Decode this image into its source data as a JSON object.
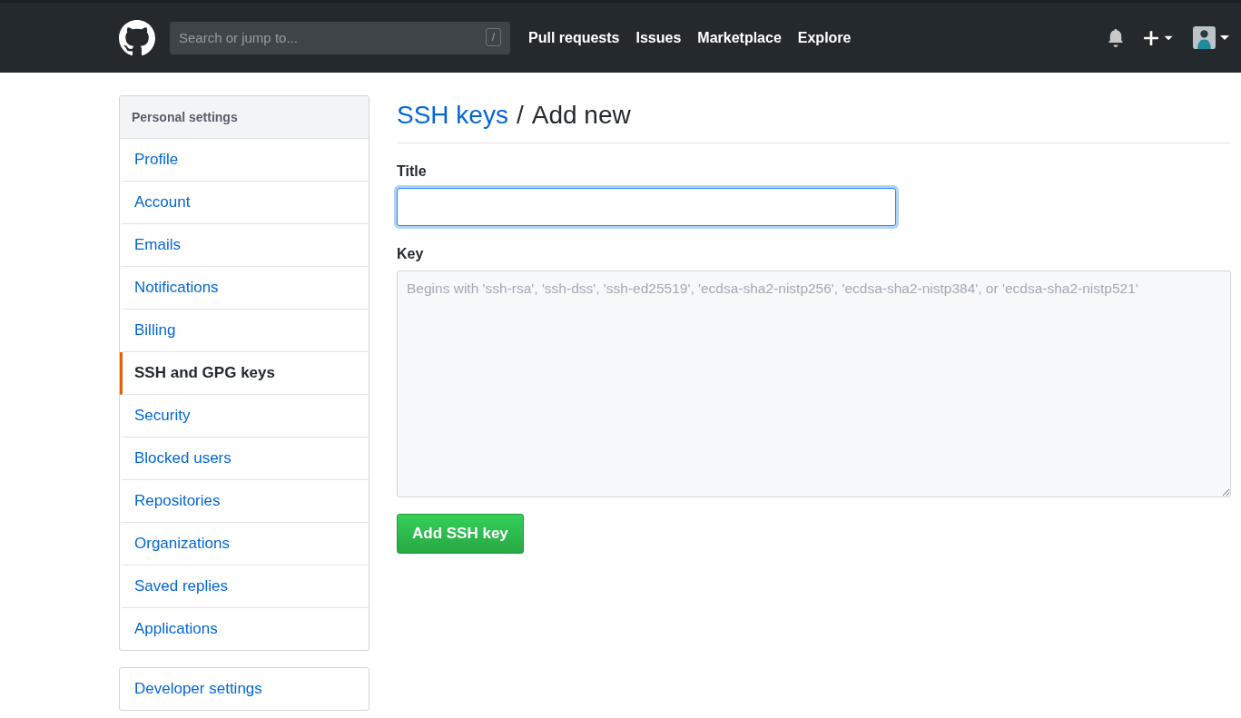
{
  "header": {
    "search": {
      "placeholder": "Search or jump to...",
      "shortcut": "/"
    },
    "nav": [
      "Pull requests",
      "Issues",
      "Marketplace",
      "Explore"
    ]
  },
  "sidebar": {
    "heading": "Personal settings",
    "items": [
      {
        "label": "Profile",
        "selected": false
      },
      {
        "label": "Account",
        "selected": false
      },
      {
        "label": "Emails",
        "selected": false
      },
      {
        "label": "Notifications",
        "selected": false
      },
      {
        "label": "Billing",
        "selected": false
      },
      {
        "label": "SSH and GPG keys",
        "selected": true
      },
      {
        "label": "Security",
        "selected": false
      },
      {
        "label": "Blocked users",
        "selected": false
      },
      {
        "label": "Repositories",
        "selected": false
      },
      {
        "label": "Organizations",
        "selected": false
      },
      {
        "label": "Saved replies",
        "selected": false
      },
      {
        "label": "Applications",
        "selected": false
      }
    ],
    "developer": "Developer settings"
  },
  "page": {
    "breadcrumb_link": "SSH keys",
    "separator": "/",
    "title": "Add new"
  },
  "form": {
    "title_label": "Title",
    "key_label": "Key",
    "key_placeholder": "Begins with 'ssh-rsa', 'ssh-dss', 'ssh-ed25519', 'ecdsa-sha2-nistp256', 'ecdsa-sha2-nistp384', or 'ecdsa-sha2-nistp521'",
    "submit": "Add SSH key"
  }
}
